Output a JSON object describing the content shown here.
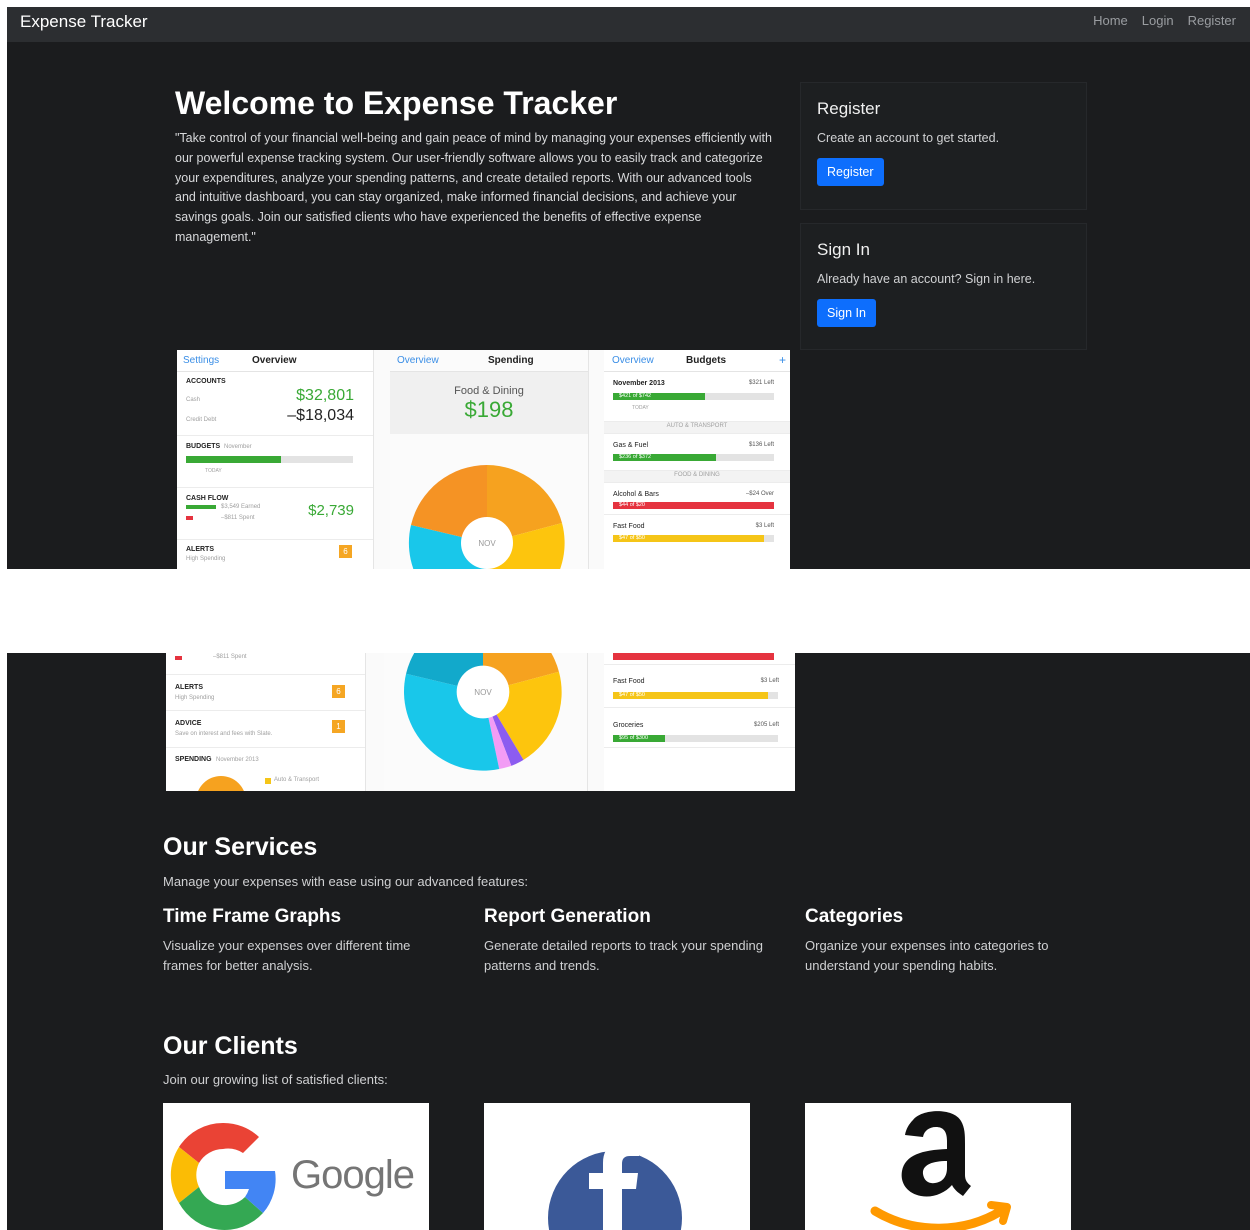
{
  "nav": {
    "brand": "Expense Tracker",
    "links": [
      "Home",
      "Login",
      "Register"
    ]
  },
  "hero": {
    "title": "Welcome to Expense Tracker",
    "text": "\"Take control of your financial well-being and gain peace of mind by managing your expenses efficiently with our powerful expense tracking system. Our user-friendly software allows you to easily track and categorize your expenditures, analyze your spending patterns, and create detailed reports. With our advanced tools and intuitive dashboard, you can stay organized, make informed financial decisions, and achieve your savings goals. Join our satisfied clients who have experienced the benefits of effective expense management.\""
  },
  "register_card": {
    "title": "Register",
    "text": "Create an account to get started.",
    "button": "Register"
  },
  "signin_card": {
    "title": "Sign In",
    "text": "Already have an account? Sign in here.",
    "button": "Sign In"
  },
  "app_preview": {
    "overview": {
      "back": "Settings",
      "title": "Overview",
      "accounts_label": "ACCOUNTS",
      "cash_label": "Cash",
      "credit_label": "Credit Debt",
      "cash_value": "$32,801",
      "credit_value": "–$18,034",
      "budgets_label": "BUDGETS",
      "budgets_month": "November",
      "today": "TODAY",
      "cashflow_label": "CASH FLOW",
      "earned": "$3,549 Earned",
      "spent": "–$811 Spent",
      "cashflow_value": "$2,739",
      "alerts_label": "ALERTS",
      "alerts_sub": "High Spending",
      "alerts_count": "6",
      "advice_label": "ADVICE",
      "advice_sub": "Save on interest and fees with Slate.",
      "advice_count": "1",
      "spending_label": "SPENDING",
      "spending_month": "November 2013",
      "legend_auto": "Auto & Transport"
    },
    "spending": {
      "back": "Overview",
      "title": "Spending",
      "category": "Food & Dining",
      "amount": "$198",
      "center": "NOV"
    },
    "budgets": {
      "back": "Overview",
      "title": "Budgets",
      "plus": "+",
      "month": "November 2013",
      "month_left": "$321 Left",
      "month_bar": "$421 of $742",
      "today": "TODAY",
      "auto_header": "AUTO & TRANSPORT",
      "gas": "Gas & Fuel",
      "gas_left": "$136 Left",
      "gas_bar": "$236 of $372",
      "food_header": "FOOD & DINING",
      "alcohol": "Alcohol & Bars",
      "alcohol_left": "–$24 Over",
      "alcohol_bar": "$44 of $20",
      "fast": "Fast Food",
      "fast_left": "$3 Left",
      "fast_bar": "$47 of $50",
      "groceries": "Groceries",
      "groceries_left": "$205 Left",
      "groceries_bar": "$95 of $300"
    }
  },
  "services": {
    "title": "Our Services",
    "subtitle": "Manage your expenses with ease using our advanced features:",
    "items": [
      {
        "title": "Time Frame Graphs",
        "text": "Visualize your expenses over different time frames for better analysis."
      },
      {
        "title": "Report Generation",
        "text": "Generate detailed reports to track your spending patterns and trends."
      },
      {
        "title": "Categories",
        "text": "Organize your expenses into categories to understand your spending habits."
      }
    ]
  },
  "clients": {
    "title": "Our Clients",
    "subtitle": "Join our growing list of satisfied clients:",
    "google_word": "Google"
  },
  "colors": {
    "background": "#1b1c1e",
    "navbar": "#2c2e31",
    "primary_button": "#0d6efd",
    "money_green": "#39a935",
    "over_red": "#e5333f",
    "budget_yellow": "#f5c518"
  }
}
